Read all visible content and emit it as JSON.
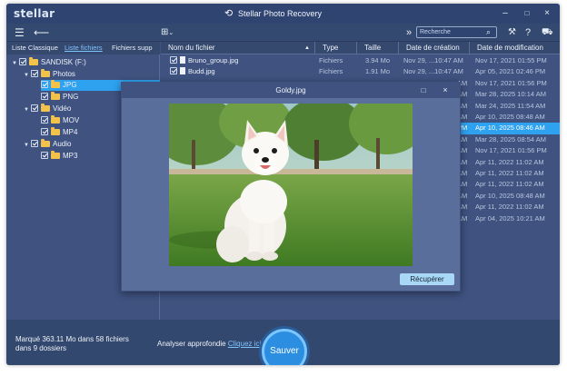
{
  "app": {
    "logo": "stellar",
    "title": "Stellar Photo Recovery",
    "controls": {
      "minimize": "–",
      "maximize": "□",
      "close": "×"
    }
  },
  "toolbar": {
    "more": "»",
    "search_placeholder": "Recherche"
  },
  "tabs": [
    {
      "label": "Liste Classique"
    },
    {
      "label": "Liste fichiers"
    },
    {
      "label": "Fichiers supp"
    }
  ],
  "tree": [
    {
      "label": "SANDISK (F:)"
    },
    {
      "label": "Photos"
    },
    {
      "label": "JPG"
    },
    {
      "label": "PNG"
    },
    {
      "label": "Vidéo"
    },
    {
      "label": "MOV"
    },
    {
      "label": "MP4"
    },
    {
      "label": "Audio"
    },
    {
      "label": "MP3"
    }
  ],
  "columns": {
    "name": "Nom du fichier",
    "type": "Type",
    "size": "Taille",
    "created": "Date de création",
    "modified": "Date de modification"
  },
  "files": [
    {
      "name": "Bruno_group.jpg",
      "type": "Fichiers",
      "size": "3.94 Mo",
      "created": "Nov 29, ...10:47 AM",
      "modified": "Nov 17, 2021 01:55 PM"
    },
    {
      "name": "Budd.jpg",
      "type": "Fichiers",
      "size": "1.91 Mo",
      "created": "Nov 29, ...10:47 AM",
      "modified": "Apr 05, 2021 02:46 PM"
    },
    {
      "name": "",
      "type": "",
      "size": "",
      "created": "AM",
      "modified": "Nov 17, 2021 01:56 PM"
    },
    {
      "name": "",
      "type": "",
      "size": "",
      "created": "AM",
      "modified": "Mar 28, 2025 10:14 AM"
    },
    {
      "name": "",
      "type": "",
      "size": "",
      "created": "AM",
      "modified": "Mar 24, 2025 11:54 AM"
    },
    {
      "name": "",
      "type": "",
      "size": "",
      "created": "AM",
      "modified": "Apr 10, 2025 08:48 AM"
    },
    {
      "name": "",
      "type": "",
      "size": "",
      "created": "PM",
      "modified": "Apr 10, 2025 08:46 AM"
    },
    {
      "name": "",
      "type": "",
      "size": "",
      "created": "AM",
      "modified": "Mar 28, 2025 08:54 AM"
    },
    {
      "name": "",
      "type": "",
      "size": "",
      "created": "AM",
      "modified": "Nov 17, 2021 01:56 PM"
    },
    {
      "name": "",
      "type": "",
      "size": "",
      "created": "AM",
      "modified": "Apr 11, 2022 11:02 AM"
    },
    {
      "name": "",
      "type": "",
      "size": "",
      "created": "AM",
      "modified": "Apr 11, 2022 11:02 AM"
    },
    {
      "name": "",
      "type": "",
      "size": "",
      "created": "AM",
      "modified": "Apr 11, 2022 11:02 AM"
    },
    {
      "name": "",
      "type": "",
      "size": "",
      "created": "AM",
      "modified": "Apr 10, 2025 08:48 AM"
    },
    {
      "name": "",
      "type": "",
      "size": "",
      "created": "AM",
      "modified": "Apr 11, 2022 11:02 AM"
    },
    {
      "name": "",
      "type": "",
      "size": "",
      "created": "AM",
      "modified": "Apr 04, 2025 10:21 AM"
    }
  ],
  "modal": {
    "title": "Goldy.jpg",
    "recover_label": "Récupérer"
  },
  "footer": {
    "status": "Marqué 363.11 Mo dans 58 fichiers dans 9 dossiers",
    "deep_scan_text": "Analyser approfondie",
    "deep_scan_link": "Cliquez ici",
    "save_label": "Sauver"
  },
  "colors": {
    "app_bg": "#3f5280",
    "selection": "#2ea1ef",
    "accent_link": "#7fc3ff",
    "folder": "#f3c24a"
  }
}
